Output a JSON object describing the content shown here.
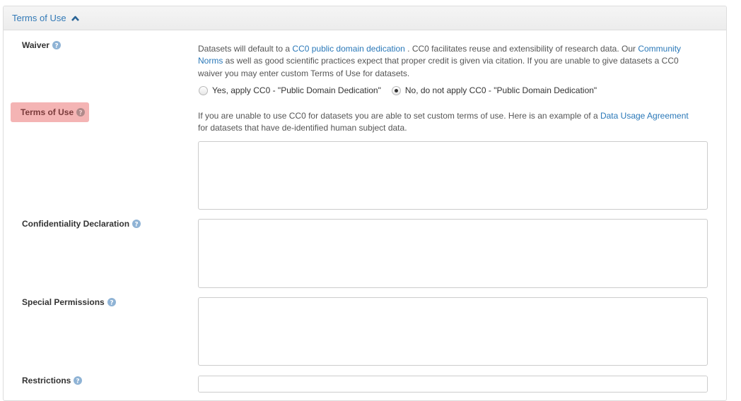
{
  "panel": {
    "title": "Terms of Use"
  },
  "waiver": {
    "label": "Waiver",
    "text_before": "Datasets will default to a ",
    "link1": "CC0 public domain dedication",
    "text_mid": " . CC0 facilitates reuse and extensibility of research data. Our ",
    "link2": "Community Norms",
    "text_after": " as well as good scientific practices expect that proper credit is given via citation. If you are unable to give datasets a CC0 waiver you may enter custom Terms of Use for datasets.",
    "options": [
      {
        "label": "Yes, apply CC0 - \"Public Domain Dedication\"",
        "checked": false
      },
      {
        "label": "No, do not apply CC0 - \"Public Domain Dedication\"",
        "checked": true
      }
    ]
  },
  "terms_of_use": {
    "label": "Terms of Use",
    "text_before": "If you are unable to use CC0 for datasets you are able to set custom terms of use. Here is an example of a ",
    "link": "Data Usage Agreement",
    "text_after": " for datasets that have de-identified human subject data.",
    "value": ""
  },
  "confidentiality": {
    "label": "Confidentiality Declaration",
    "value": ""
  },
  "special_permissions": {
    "label": "Special Permissions",
    "value": ""
  },
  "restrictions": {
    "label": "Restrictions",
    "value": ""
  },
  "colors": {
    "link": "#2a78b8",
    "error_bg": "#f4b4b4",
    "help_icon": "#8fb3d5"
  }
}
